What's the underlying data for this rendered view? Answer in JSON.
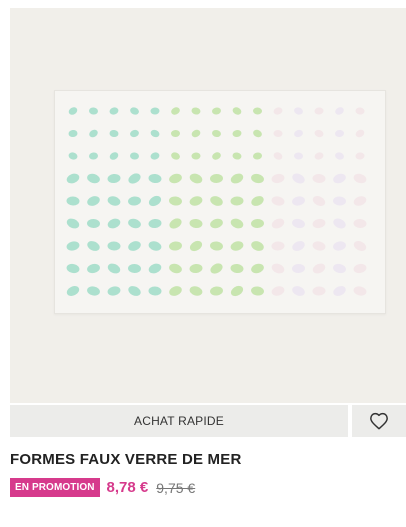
{
  "product": {
    "quick_buy_label": "ACHAT RAPIDE",
    "title": "FORMES FAUX VERRE DE MER",
    "badge": "EN PROMOTION",
    "sale_price": "8,78 €",
    "original_price": "9,75 €"
  },
  "image": {
    "gem_colors": [
      "#9fdcc8",
      "#bfe2a4",
      "#e8dff0",
      "#f1dfe4"
    ]
  },
  "icons": {
    "favorite": "heart-icon"
  }
}
